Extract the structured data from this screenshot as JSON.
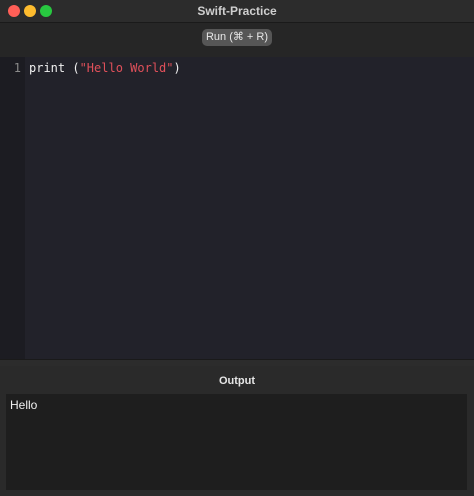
{
  "window": {
    "title": "Swift-Practice"
  },
  "toolbar": {
    "run_label": "Run (⌘ + R)"
  },
  "editor": {
    "line_number": "1",
    "code_prefix": "print (",
    "code_string": "\"Hello World\"",
    "code_suffix": ")"
  },
  "output": {
    "label": "Output",
    "text": "Hello"
  },
  "colors": {
    "string_literal": "#e0505a",
    "close": "#ff5f57",
    "minimize": "#febc2e",
    "maximize": "#28c840"
  },
  "icons": {
    "close": "close-icon",
    "minimize": "minimize-icon",
    "maximize": "maximize-icon"
  }
}
